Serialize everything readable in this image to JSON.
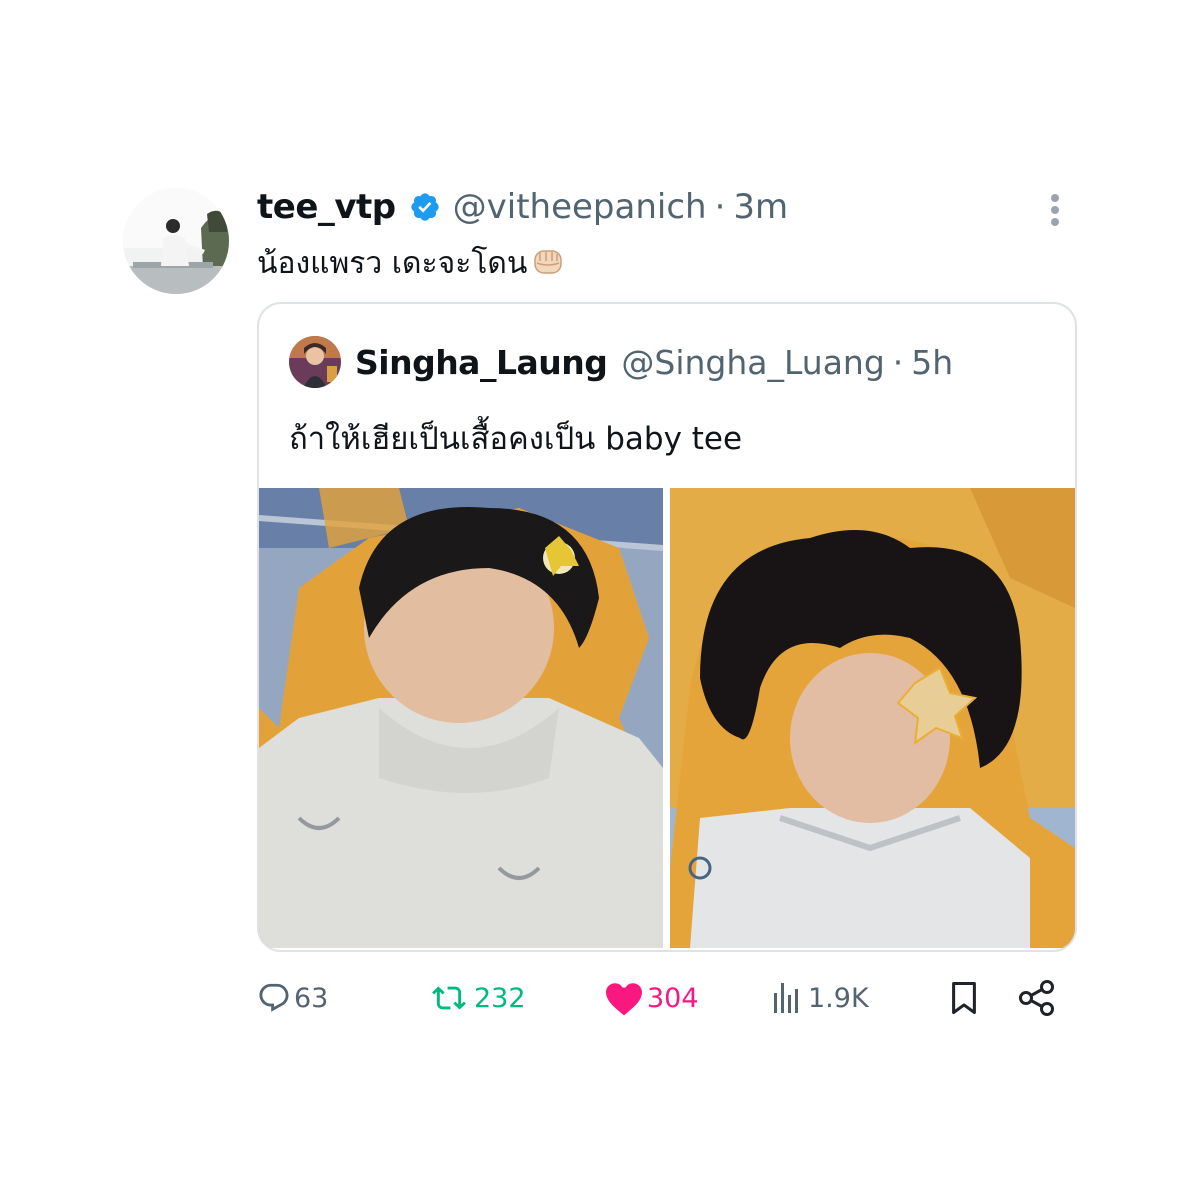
{
  "author": {
    "display_name": "tee_vtp",
    "handle": "@vitheepanich",
    "time": "3m",
    "verified": true,
    "avatar_icon": "profile-photo"
  },
  "tweet": {
    "text": "น้องแพรว เดะจะโดน",
    "emoji": "oncoming-fist"
  },
  "quoted": {
    "display_name": "Singha_Laung",
    "handle": "@Singha_Luang",
    "time": "5h",
    "text": "ถ้าให้เฮียเป็นเสื้อคงเป็น baby tee",
    "images": [
      "left-photo",
      "right-photo"
    ]
  },
  "separator": "·",
  "metrics": {
    "replies": "63",
    "retweets": "232",
    "likes": "304",
    "views": "1.9K"
  },
  "colors": {
    "text": "#0f1419",
    "secondary": "#536471",
    "verified": "#1d9bf0",
    "retweet": "#00ba7c",
    "like": "#f91880",
    "border": "#dfe3e6"
  }
}
